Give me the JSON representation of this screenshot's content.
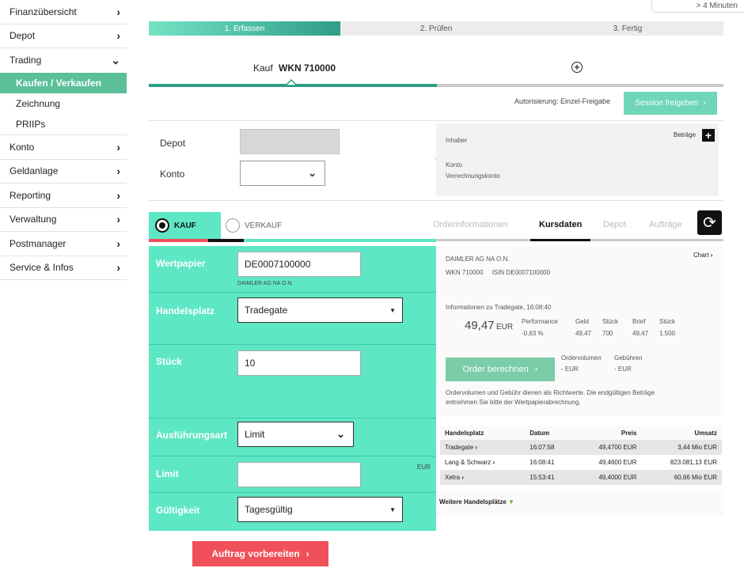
{
  "sidebar": {
    "items": [
      {
        "label": "Finanzübersicht"
      },
      {
        "label": "Depot"
      },
      {
        "label": "Trading"
      },
      {
        "label": "Konto"
      },
      {
        "label": "Geldanlage"
      },
      {
        "label": "Reporting"
      },
      {
        "label": "Verwaltung"
      },
      {
        "label": "Postmanager"
      },
      {
        "label": "Service & Infos"
      }
    ],
    "trading_sub": [
      {
        "label": "Kaufen / Verkaufen"
      },
      {
        "label": "Zeichnung"
      },
      {
        "label": "PRIIPs"
      }
    ]
  },
  "timer": "> 4 Minuten",
  "steps": [
    "1. Erfassen",
    "2. Prüfen",
    "3. Fertig"
  ],
  "header": {
    "kauf": "Kauf",
    "wkn": "WKN 710000"
  },
  "auth": {
    "label": "Autorisierung: Einzel-Freigabe",
    "session_button": "Session freigeben"
  },
  "depot_section": {
    "depot_label": "Depot",
    "konto_label": "Konto",
    "inhaber": "Inhaber",
    "konto": "Konto",
    "verrechnungskonto": "Verrechnungskonto",
    "betraege": "Beträge"
  },
  "order_side": {
    "kauf": "KAUF",
    "verkauf": "VERKAUF"
  },
  "right_tabs": [
    "Orderinformationen",
    "Kursdaten",
    "Depot",
    "Aufträge"
  ],
  "form": {
    "wertpapier_label": "Wertpapier",
    "wertpapier_value": "DE0007100000",
    "wertpapier_note": "DAIMLER AG NA O.N.",
    "handelsplatz_label": "Handelsplatz",
    "handelsplatz_value": "Tradegate",
    "stueck_label": "Stück",
    "stueck_value": "10",
    "ausfuehrungsart_label": "Ausführungsart",
    "ausfuehrungsart_value": "Limit",
    "limit_label": "Limit",
    "limit_value": "",
    "limit_currency": "EUR",
    "gueltigkeit_label": "Gültigkeit",
    "gueltigkeit_value": "Tagesgültig",
    "submit": "Auftrag vorbereiten"
  },
  "kursdaten": {
    "name": "DAIMLER AG NA O.N.",
    "wkn_isin": "WKN 710000     ISIN DE0007100000",
    "chart": "Chart",
    "info": "Informationen zu Tradegate, 16:08:40",
    "price": "49,47",
    "currency": "EUR",
    "performance_label": "Performance",
    "performance_value": "-0,63 %",
    "geld_label": "Geld",
    "geld_value": "49,47",
    "stueck1_label": "Stück",
    "stueck1_value": "700",
    "brief_label": "Brief",
    "brief_value": "49,47",
    "stueck2_label": "Stück",
    "stueck2_value": "1.500",
    "order_button": "Order berechnen",
    "ordervolumen_label": "Ordervolumen",
    "ordervolumen_value": "- EUR",
    "gebuehren_label": "Gebühren",
    "gebuehren_value": "- EUR",
    "disclaimer_1": "Ordervolumen und Gebühr dienen als Richtwerte. Die endgültigen Beträge",
    "disclaimer_2": "entnehmen Sie bitte der Wertpapierabrechnung."
  },
  "table": {
    "headers": [
      "Handelsplatz",
      "Datum",
      "Preis",
      "Umsatz"
    ],
    "rows": [
      [
        "Tradegate",
        "16:07:58",
        "49,4700 EUR",
        "3,44 Mio EUR"
      ],
      [
        "Lang & Schwarz",
        "16:08:41",
        "49,4600 EUR",
        "823.081,13 EUR"
      ],
      [
        "Xetra",
        "15:53:41",
        "49,4000 EUR",
        "60,66 Mio EUR"
      ]
    ],
    "more": "Weitere Handelsplätze"
  },
  "colors": {
    "accent": "#5ee7c4",
    "primary": "#2f9d88",
    "danger": "#f0505a"
  }
}
